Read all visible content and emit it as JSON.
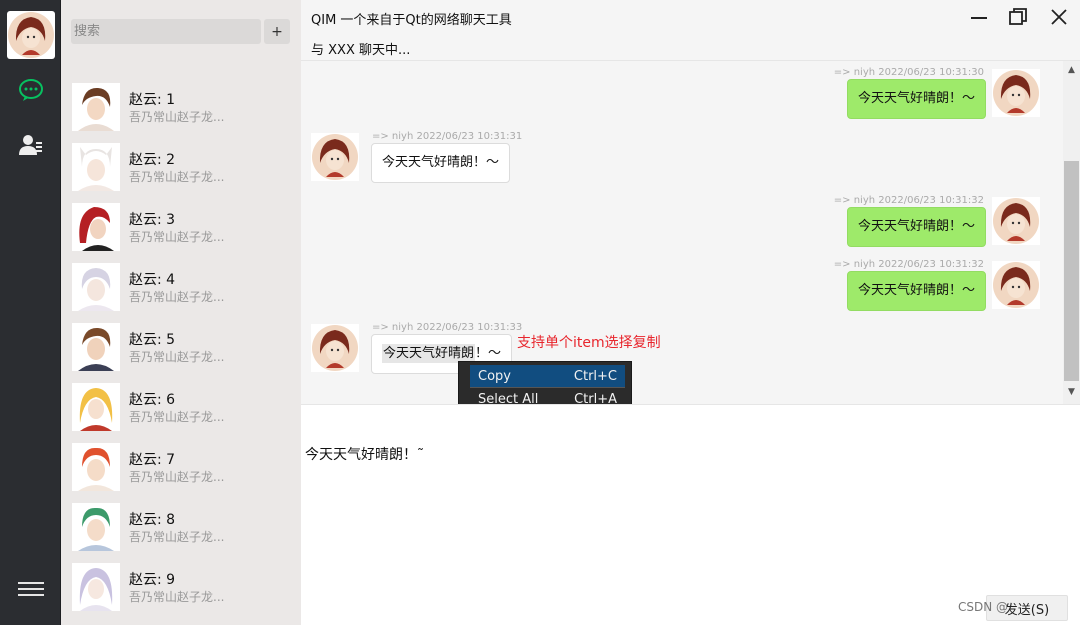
{
  "window": {
    "app_title": "QIM 一个来自于Qt的网络聊天工具",
    "chat_title": "与 XXX 聊天中..."
  },
  "search": {
    "placeholder": "搜索"
  },
  "add_button_label": "+",
  "contacts": [
    {
      "name": "赵云: 1",
      "signature": "吾乃常山赵子龙..."
    },
    {
      "name": "赵云: 2",
      "signature": "吾乃常山赵子龙..."
    },
    {
      "name": "赵云: 3",
      "signature": "吾乃常山赵子龙..."
    },
    {
      "name": "赵云: 4",
      "signature": "吾乃常山赵子龙..."
    },
    {
      "name": "赵云: 5",
      "signature": "吾乃常山赵子龙..."
    },
    {
      "name": "赵云: 6",
      "signature": "吾乃常山赵子龙..."
    },
    {
      "name": "赵云: 7",
      "signature": "吾乃常山赵子龙..."
    },
    {
      "name": "赵云: 8",
      "signature": "吾乃常山赵子龙..."
    },
    {
      "name": "赵云: 9",
      "signature": "吾乃常山赵子龙..."
    }
  ],
  "messages": [
    {
      "direction": "out",
      "meta": "=> niyh 2022/06/23 10:31:30",
      "text": "今天天气好晴朗！～"
    },
    {
      "direction": "in",
      "meta": "=> niyh 2022/06/23 10:31:31",
      "text": "今天天气好晴朗！～"
    },
    {
      "direction": "out",
      "meta": "=> niyh 2022/06/23 10:31:32",
      "text": "今天天气好晴朗！～"
    },
    {
      "direction": "out",
      "meta": "=> niyh 2022/06/23 10:31:32",
      "text": "今天天气好晴朗！～"
    },
    {
      "direction": "in",
      "meta": "=> niyh 2022/06/23 10:31:33",
      "text_selected": "今天天气好晴朗",
      "text_rest": "！～"
    }
  ],
  "annotation": "支持单个item选择复制",
  "context_menu": [
    {
      "label": "Copy",
      "shortcut": "Ctrl+C"
    },
    {
      "label": "Select All",
      "shortcut": "Ctrl+A"
    }
  ],
  "draft_text": "今天天气好晴朗！˜",
  "send_button_label": "发送(S)",
  "watermark": "CSDN @",
  "colors": {
    "rail_bg": "#2b2d31",
    "chat_icon_green": "#07c160",
    "bubble_out": "#9eea6a",
    "annotation_red": "#e8262d",
    "menu_highlight": "#114d80"
  },
  "icons": {
    "chat": "chat-bubble-icon",
    "contacts": "contacts-icon",
    "menu": "hamburger-menu-icon",
    "minimize": "minimize-icon",
    "maximize": "maximize-icon",
    "close": "close-icon"
  }
}
